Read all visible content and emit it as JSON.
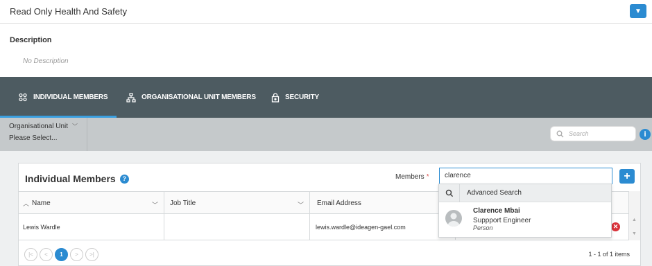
{
  "header": {
    "title": "Read Only Health And Safety"
  },
  "description": {
    "label": "Description",
    "value": "No Description"
  },
  "tabs": [
    {
      "label": "INDIVIDUAL MEMBERS",
      "icon": "individual-members-icon",
      "active": true
    },
    {
      "label": "ORGANISATIONAL UNIT MEMBERS",
      "icon": "org-unit-icon",
      "active": false
    },
    {
      "label": "SECURITY",
      "icon": "lock-icon",
      "active": false
    }
  ],
  "filter": {
    "org_unit_label": "Organisational Unit",
    "org_unit_value": "Please Select...",
    "search_placeholder": "Search"
  },
  "panel": {
    "title": "Individual Members",
    "members_label": "Members",
    "members_required": "*",
    "members_input": "clarence",
    "columns": [
      "Name",
      "Job Title",
      "Email Address"
    ],
    "rows": [
      {
        "name": "Lewis Wardle",
        "job_title": "",
        "email": "lewis.wardle@ideagen-gael.com"
      }
    ],
    "pagination": {
      "current": "1",
      "count_text": "1 - 1 of 1 items"
    }
  },
  "dropdown": {
    "advanced_search": "Advanced Search",
    "results": [
      {
        "name": "Clarence Mbai",
        "role": "Suppport Engineer",
        "type": "Person"
      }
    ]
  },
  "colors": {
    "accent": "#2b8bd1",
    "tabbar": "#4d5b61",
    "filterbar": "#c5c9cb",
    "delete": "#d9323a"
  }
}
